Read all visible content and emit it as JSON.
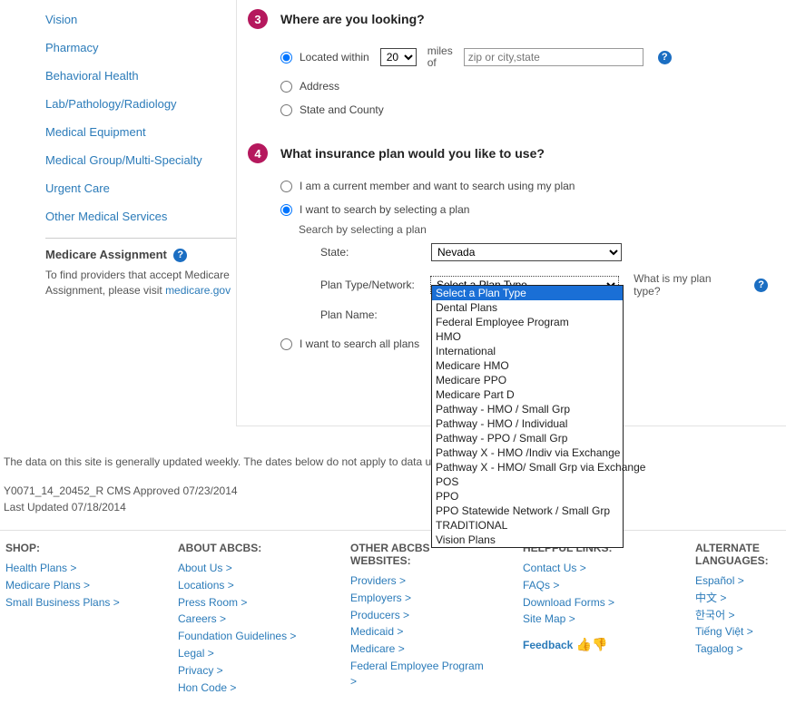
{
  "sidebar": {
    "links": [
      "Vision",
      "Pharmacy",
      "Behavioral Health",
      "Lab/Pathology/Radiology",
      "Medical Equipment",
      "Medical Group/Multi-Specialty",
      "Urgent Care",
      "Other Medical Services"
    ],
    "medicare_title": "Medicare Assignment",
    "medicare_text_pre": "To find providers that accept Medicare Assignment, please visit ",
    "medicare_link": "medicare.gov"
  },
  "step3": {
    "num": "3",
    "title": "Where are you looking?",
    "located_within": "Located within",
    "distance": "20",
    "miles_of": "miles of",
    "zip_placeholder": "zip or city,state",
    "address": "Address",
    "state_county": "State and County"
  },
  "step4": {
    "num": "4",
    "title": "What insurance plan would you like to use?",
    "opt_member": "I am a current member and want to search using my plan",
    "opt_select": "I want to search by selecting a plan",
    "search_by": "Search by selecting a plan",
    "state_label": "State:",
    "state_value": "Nevada",
    "plan_type_label": "Plan Type/Network:",
    "plan_type_value": "Select a Plan Type",
    "plan_help": "What is my plan type?",
    "plan_name_label": "Plan Name:",
    "opt_all": "I want to search all plans",
    "plan_type_options": [
      "Select a Plan Type",
      "Dental Plans",
      "Federal Employee Program",
      "HMO",
      "International",
      "Medicare HMO",
      "Medicare PPO",
      "Medicare Part D",
      "Pathway - HMO / Small Grp",
      "Pathway - HMO / Individual",
      "Pathway - PPO / Small Grp",
      "Pathway X - HMO /Indiv via Exchange",
      "Pathway X - HMO/ Small Grp via Exchange",
      "POS",
      "PPO",
      "PPO Statewide Network / Small Grp",
      "TRADITIONAL",
      "Vision Plans"
    ]
  },
  "disclaimer": {
    "line1": "The data on this site is generally updated weekly. The dates below do not apply to data updates.",
    "line2": "Y0071_14_20452_R CMS Approved 07/23/2014",
    "line3": "Last Updated 07/18/2014"
  },
  "footer": {
    "shop": {
      "title": "SHOP:",
      "links": [
        "Health Plans >",
        "Medicare Plans >",
        "Small Business Plans >"
      ]
    },
    "about": {
      "title": "ABOUT ABCBS:",
      "links": [
        "About Us >",
        "Locations >",
        "Press Room >",
        "Careers >",
        "Foundation Guidelines >",
        "Legal >",
        "Privacy >",
        "Hon Code >"
      ]
    },
    "other": {
      "title": "OTHER ABCBS WEBSITES:",
      "links": [
        "Providers >",
        "Employers >",
        "Producers >",
        "Medicaid >",
        "Medicare >",
        "Federal Employee Program >"
      ]
    },
    "help": {
      "title": "HELPFUL LINKS:",
      "links": [
        "Contact Us >",
        "FAQs >",
        "Download Forms >",
        "Site Map >"
      ],
      "feedback": "Feedback"
    },
    "lang": {
      "title": "ALTERNATE LANGUAGES:",
      "links": [
        "Español >",
        "中文 >",
        "한국어 >",
        "Tiếng Việt >",
        "Tagalog >"
      ]
    }
  }
}
